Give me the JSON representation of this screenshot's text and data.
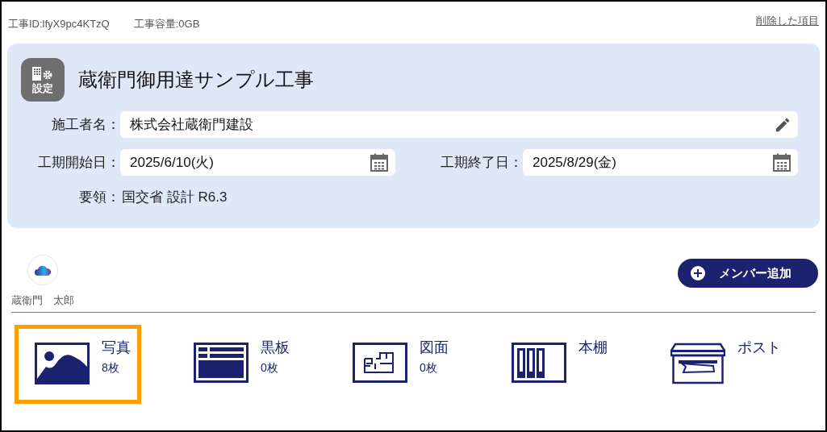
{
  "header": {
    "project_id": "工事ID:lfyX9pc4KTzQ",
    "capacity": "工事容量:0GB",
    "deleted_link": "削除した項目"
  },
  "project": {
    "settings_label": "設定",
    "title": "蔵衛門御用達サンプル工事",
    "contractor": {
      "label": "施工者名：",
      "value": "株式会社蔵衛門建設"
    },
    "start": {
      "label": "工期開始日：",
      "value": "2025/6/10(火)"
    },
    "end": {
      "label": "工期終了日：",
      "value": "2025/8/29(金)"
    },
    "standard": {
      "label": "要領：",
      "value": "国交省 設計 R6.3"
    }
  },
  "members": [
    {
      "name": "蔵衛門　太郎"
    }
  ],
  "add_member_button": "メンバー追加",
  "tiles": [
    {
      "kind": "photo",
      "label": "写真",
      "count": "8枚",
      "selected": true
    },
    {
      "kind": "board",
      "label": "黒板",
      "count": "0枚",
      "selected": false
    },
    {
      "kind": "drawing",
      "label": "図面",
      "count": "0枚",
      "selected": false
    },
    {
      "kind": "shelf",
      "label": "本棚",
      "selected": false
    },
    {
      "kind": "post",
      "label": "ポスト",
      "selected": false
    }
  ]
}
